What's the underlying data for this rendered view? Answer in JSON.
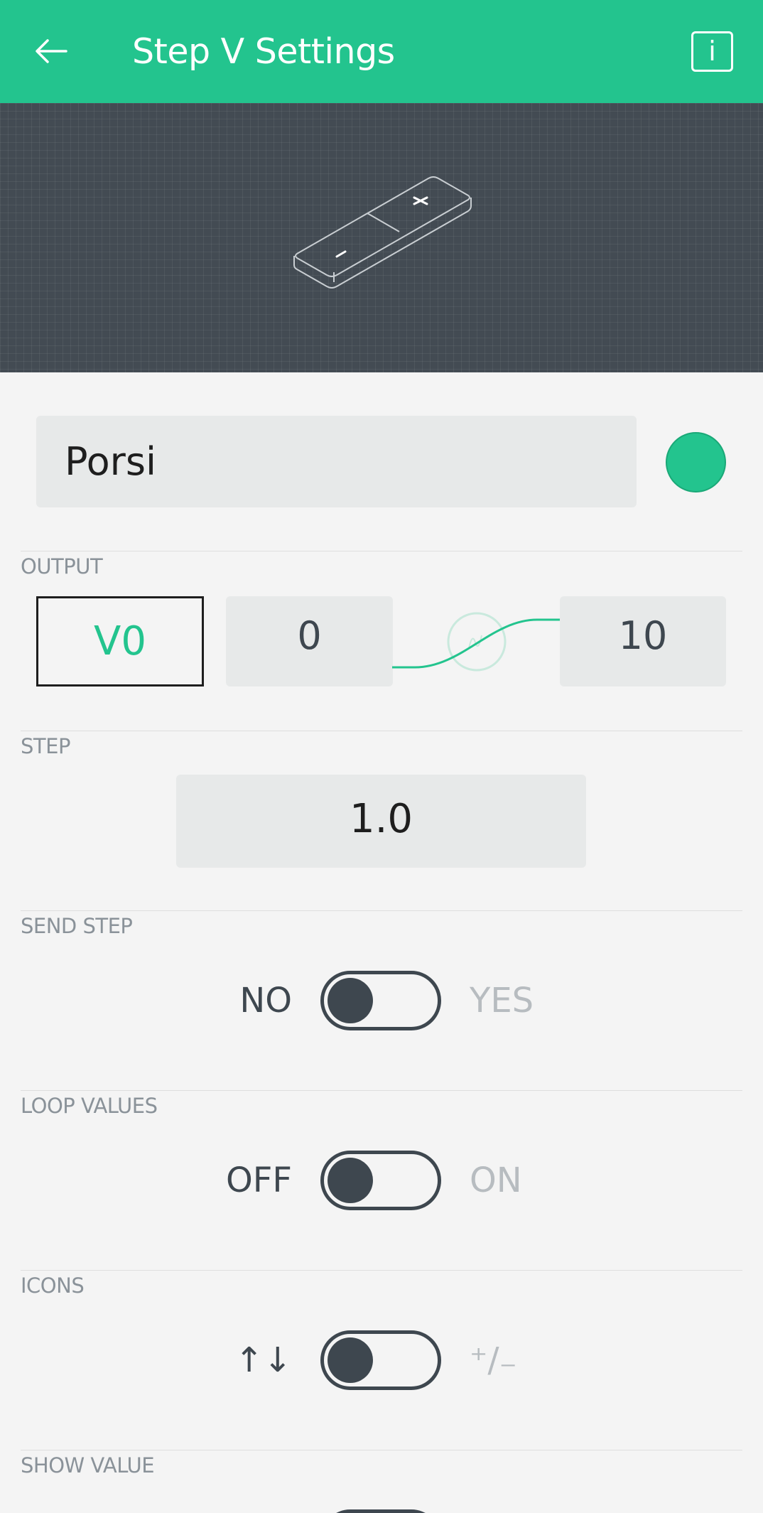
{
  "header": {
    "title": "Step V Settings",
    "info_label": "i"
  },
  "name_field": {
    "value": "Porsi"
  },
  "widget_color": "#23c48e",
  "output": {
    "label": "OUTPUT",
    "pin": "V0",
    "min": "0",
    "max": "10"
  },
  "step": {
    "label": "STEP",
    "value": "1.0"
  },
  "send_step": {
    "label": "SEND STEP",
    "off_label": "NO",
    "on_label": "YES",
    "enabled": false
  },
  "loop_values": {
    "label": "LOOP VALUES",
    "off_label": "OFF",
    "on_label": "ON",
    "enabled": false
  },
  "icons": {
    "label": "ICONS",
    "off_label": "↑↓",
    "on_label": "⁺/₋",
    "enabled": false
  },
  "show_value": {
    "label": "SHOW VALUE"
  }
}
